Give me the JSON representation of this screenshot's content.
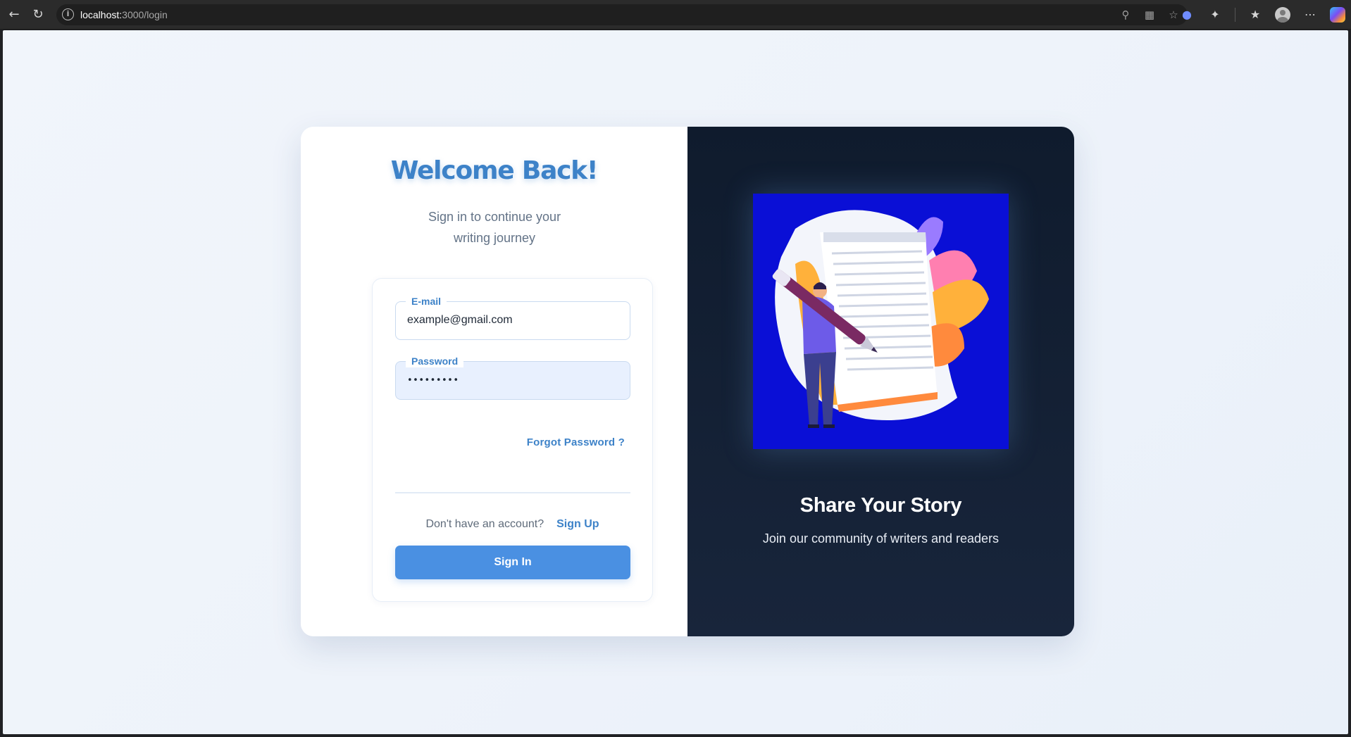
{
  "browser": {
    "url_host": "localhost:",
    "url_rest": "3000/login",
    "back_icon": "arrow-left",
    "reload_icon": "refresh",
    "info_icon": "i"
  },
  "login": {
    "title": "Welcome Back!",
    "subtitle": "Sign in to continue your writing journey",
    "email_label": "E-mail",
    "email_value": "example@gmail.com",
    "password_label": "Password",
    "password_value": "•••••••••",
    "forgot_link": "Forgot Password ?",
    "no_account_text": "Don't have an account?",
    "signup_link": "Sign Up",
    "signin_button": "Sign In"
  },
  "promo": {
    "title": "Share Your Story",
    "subtitle": "Join our community of writers and readers"
  },
  "colors": {
    "accent": "#4a90e2",
    "title_blue": "#3d82c8",
    "panel_dark": "#0f1b2d",
    "illustration_bg": "#0a0fd6"
  }
}
